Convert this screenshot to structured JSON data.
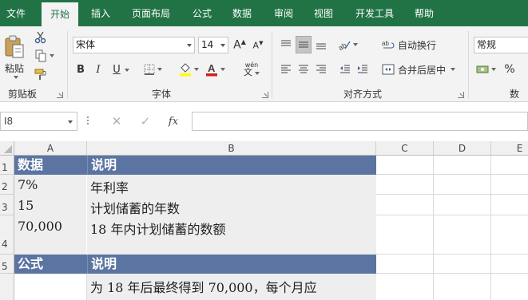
{
  "ribbon_tabs": [
    "文件",
    "开始",
    "插入",
    "页面布局",
    "公式",
    "数据",
    "审阅",
    "视图",
    "开发工具",
    "帮助"
  ],
  "active_tab": "开始",
  "clipboard": {
    "paste_label": "粘贴",
    "group_label": "剪贴板"
  },
  "font": {
    "name": "宋体",
    "size": "14",
    "bold": "B",
    "italic": "I",
    "underline": "U",
    "phonetic": "wén",
    "group_label": "字体"
  },
  "alignment": {
    "wrap_text": "自动换行",
    "merge_center": "合并后居中",
    "group_label": "对齐方式"
  },
  "number": {
    "format": "常规",
    "percent": "%",
    "group_label": "数字"
  },
  "formula_bar": {
    "name_box": "I8",
    "fx": "fx",
    "value": ""
  },
  "columns": [
    "A",
    "B",
    "C",
    "D",
    "E"
  ],
  "rows": [
    "1",
    "2",
    "3",
    "4",
    "5"
  ],
  "cells": {
    "A1": "数据",
    "B1": "说明",
    "A2": "7%",
    "B2": "年利率",
    "A3": "15",
    "B3": "计划储蓄的年数",
    "A4": "70,000",
    "B4": "18 年内计划储蓄的数额",
    "A5": "公式",
    "B5": "说明",
    "B6": "为 18 年后最终得到 70,000，每个月应"
  },
  "colors": {
    "ribbon_green": "#217346",
    "header_fill": "#5b74a1",
    "cell_fill": "#eeeeee"
  }
}
